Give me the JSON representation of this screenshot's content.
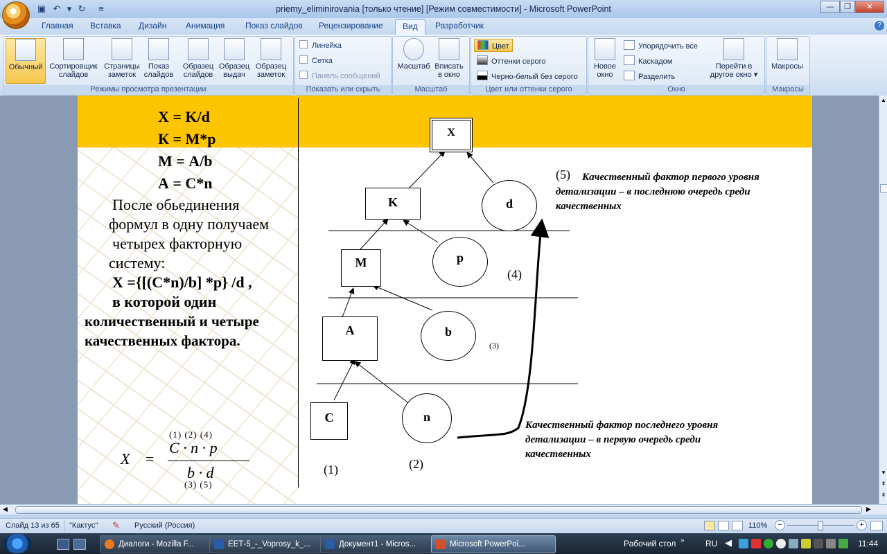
{
  "window": {
    "title": "priemy_eliminirovania [только чтение] [Режим совместимости] - Microsoft PowerPoint",
    "minimize": "—",
    "restore": "❐",
    "close": "✕"
  },
  "tabs": [
    "Главная",
    "Вставка",
    "Дизайн",
    "Анимация",
    "Показ слайдов",
    "Рецензирование",
    "Вид",
    "Разработчик"
  ],
  "ribbon": {
    "views": {
      "label": "Режимы просмотра презентации",
      "buttons": [
        {
          "l1": "Обычный",
          "l2": ""
        },
        {
          "l1": "Сортировщик",
          "l2": "слайдов"
        },
        {
          "l1": "Страницы",
          "l2": "заметок"
        },
        {
          "l1": "Показ",
          "l2": "слайдов"
        },
        {
          "l1": "Образец",
          "l2": "слайдов"
        },
        {
          "l1": "Образец",
          "l2": "выдач"
        },
        {
          "l1": "Образец",
          "l2": "заметок"
        }
      ]
    },
    "showhide": {
      "label": "Показать или скрыть",
      "ruler": "Линейка",
      "grid": "Сетка",
      "msgbar": "Панель сообщений"
    },
    "zoom": {
      "label": "Масштаб",
      "zoom_l1": "Масштаб",
      "zoom_l2": "",
      "fit_l1": "Вписать",
      "fit_l2": "в окно"
    },
    "color": {
      "label": "Цвет или оттенки серого",
      "color": "Цвет",
      "grayscale": "Оттенки серого",
      "bw": "Черно-белый без серого"
    },
    "window": {
      "label": "Окно",
      "new_l1": "Новое",
      "new_l2": "окно",
      "arrange": "Упорядочить все",
      "cascade": "Каскадом",
      "split": "Разделить",
      "switch_l1": "Перейти в",
      "switch_l2": "другое окно"
    },
    "macros": {
      "label": "Макросы",
      "btn": "Макросы"
    }
  },
  "slide": {
    "formulas": [
      "X = K/d",
      "К = М*р",
      "М = А/b",
      "А = С*n"
    ],
    "body": [
      "После обьединения",
      "формул в одну получаем",
      "четырех факторную",
      "систему:"
    ],
    "system": "X ={[(C*n)/b] *p} /d ,",
    "conclusion": [
      "в которой один",
      "количественный и четыре",
      "качественных фактора."
    ],
    "formula": {
      "x": "X",
      "eq": "=",
      "numerator": "C · n · p",
      "denominator": "b · d",
      "sup_top": "(1)  (2)  (4)",
      "sup_bottom": "(3)  (5)"
    },
    "diagram": {
      "X": "X",
      "K": "K",
      "d": "d",
      "M": "M",
      "p": "p",
      "A": "A",
      "b": "b",
      "C": "C",
      "n": "n",
      "label1": "(1)",
      "label2": "(2)",
      "label3": "(3)",
      "label4": "(4)",
      "label5": "(5)",
      "note_top": "Качественный фактор первого уровня детализации – в последнюю очередь среди качественных",
      "note_bottom": "Качественный фактор последнего уровня детализации – в первую очередь среди качественных"
    }
  },
  "status": {
    "slide": "Слайд 13 из 65",
    "theme": "\"Кактус\"",
    "language": "Русский (Россия)",
    "zoom": "110%"
  },
  "taskbar": {
    "items": [
      "Диалоги - Mozilla F...",
      "ЕЕТ-5_-_Voprosy_k_...",
      "Документ1 - Micros...",
      "Microsoft PowerPoi..."
    ],
    "desktop": "Рабочий стол",
    "lang": "RU",
    "time": "11:44"
  }
}
